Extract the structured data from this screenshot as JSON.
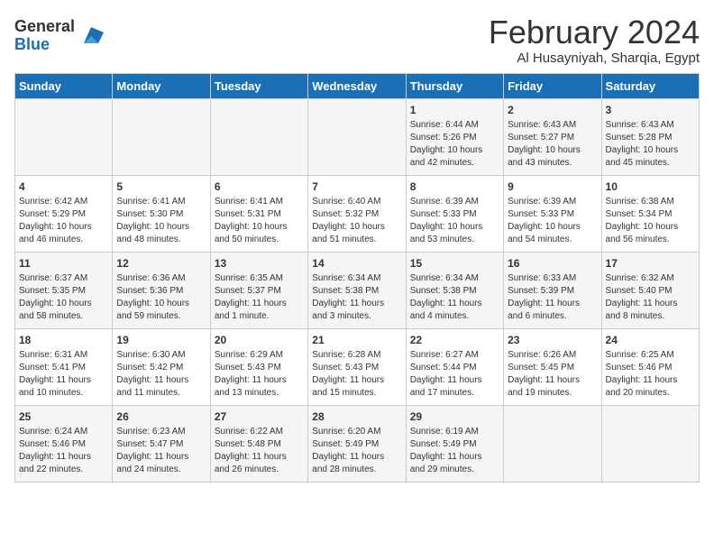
{
  "logo": {
    "general": "General",
    "blue": "Blue"
  },
  "title": "February 2024",
  "location": "Al Husayniyah, Sharqia, Egypt",
  "days_of_week": [
    "Sunday",
    "Monday",
    "Tuesday",
    "Wednesday",
    "Thursday",
    "Friday",
    "Saturday"
  ],
  "weeks": [
    [
      {
        "day": "",
        "info": ""
      },
      {
        "day": "",
        "info": ""
      },
      {
        "day": "",
        "info": ""
      },
      {
        "day": "",
        "info": ""
      },
      {
        "day": "1",
        "info": "Sunrise: 6:44 AM\nSunset: 5:26 PM\nDaylight: 10 hours\nand 42 minutes."
      },
      {
        "day": "2",
        "info": "Sunrise: 6:43 AM\nSunset: 5:27 PM\nDaylight: 10 hours\nand 43 minutes."
      },
      {
        "day": "3",
        "info": "Sunrise: 6:43 AM\nSunset: 5:28 PM\nDaylight: 10 hours\nand 45 minutes."
      }
    ],
    [
      {
        "day": "4",
        "info": "Sunrise: 6:42 AM\nSunset: 5:29 PM\nDaylight: 10 hours\nand 46 minutes."
      },
      {
        "day": "5",
        "info": "Sunrise: 6:41 AM\nSunset: 5:30 PM\nDaylight: 10 hours\nand 48 minutes."
      },
      {
        "day": "6",
        "info": "Sunrise: 6:41 AM\nSunset: 5:31 PM\nDaylight: 10 hours\nand 50 minutes."
      },
      {
        "day": "7",
        "info": "Sunrise: 6:40 AM\nSunset: 5:32 PM\nDaylight: 10 hours\nand 51 minutes."
      },
      {
        "day": "8",
        "info": "Sunrise: 6:39 AM\nSunset: 5:33 PM\nDaylight: 10 hours\nand 53 minutes."
      },
      {
        "day": "9",
        "info": "Sunrise: 6:39 AM\nSunset: 5:33 PM\nDaylight: 10 hours\nand 54 minutes."
      },
      {
        "day": "10",
        "info": "Sunrise: 6:38 AM\nSunset: 5:34 PM\nDaylight: 10 hours\nand 56 minutes."
      }
    ],
    [
      {
        "day": "11",
        "info": "Sunrise: 6:37 AM\nSunset: 5:35 PM\nDaylight: 10 hours\nand 58 minutes."
      },
      {
        "day": "12",
        "info": "Sunrise: 6:36 AM\nSunset: 5:36 PM\nDaylight: 10 hours\nand 59 minutes."
      },
      {
        "day": "13",
        "info": "Sunrise: 6:35 AM\nSunset: 5:37 PM\nDaylight: 11 hours\nand 1 minute."
      },
      {
        "day": "14",
        "info": "Sunrise: 6:34 AM\nSunset: 5:38 PM\nDaylight: 11 hours\nand 3 minutes."
      },
      {
        "day": "15",
        "info": "Sunrise: 6:34 AM\nSunset: 5:38 PM\nDaylight: 11 hours\nand 4 minutes."
      },
      {
        "day": "16",
        "info": "Sunrise: 6:33 AM\nSunset: 5:39 PM\nDaylight: 11 hours\nand 6 minutes."
      },
      {
        "day": "17",
        "info": "Sunrise: 6:32 AM\nSunset: 5:40 PM\nDaylight: 11 hours\nand 8 minutes."
      }
    ],
    [
      {
        "day": "18",
        "info": "Sunrise: 6:31 AM\nSunset: 5:41 PM\nDaylight: 11 hours\nand 10 minutes."
      },
      {
        "day": "19",
        "info": "Sunrise: 6:30 AM\nSunset: 5:42 PM\nDaylight: 11 hours\nand 11 minutes."
      },
      {
        "day": "20",
        "info": "Sunrise: 6:29 AM\nSunset: 5:43 PM\nDaylight: 11 hours\nand 13 minutes."
      },
      {
        "day": "21",
        "info": "Sunrise: 6:28 AM\nSunset: 5:43 PM\nDaylight: 11 hours\nand 15 minutes."
      },
      {
        "day": "22",
        "info": "Sunrise: 6:27 AM\nSunset: 5:44 PM\nDaylight: 11 hours\nand 17 minutes."
      },
      {
        "day": "23",
        "info": "Sunrise: 6:26 AM\nSunset: 5:45 PM\nDaylight: 11 hours\nand 19 minutes."
      },
      {
        "day": "24",
        "info": "Sunrise: 6:25 AM\nSunset: 5:46 PM\nDaylight: 11 hours\nand 20 minutes."
      }
    ],
    [
      {
        "day": "25",
        "info": "Sunrise: 6:24 AM\nSunset: 5:46 PM\nDaylight: 11 hours\nand 22 minutes."
      },
      {
        "day": "26",
        "info": "Sunrise: 6:23 AM\nSunset: 5:47 PM\nDaylight: 11 hours\nand 24 minutes."
      },
      {
        "day": "27",
        "info": "Sunrise: 6:22 AM\nSunset: 5:48 PM\nDaylight: 11 hours\nand 26 minutes."
      },
      {
        "day": "28",
        "info": "Sunrise: 6:20 AM\nSunset: 5:49 PM\nDaylight: 11 hours\nand 28 minutes."
      },
      {
        "day": "29",
        "info": "Sunrise: 6:19 AM\nSunset: 5:49 PM\nDaylight: 11 hours\nand 29 minutes."
      },
      {
        "day": "",
        "info": ""
      },
      {
        "day": "",
        "info": ""
      }
    ]
  ]
}
